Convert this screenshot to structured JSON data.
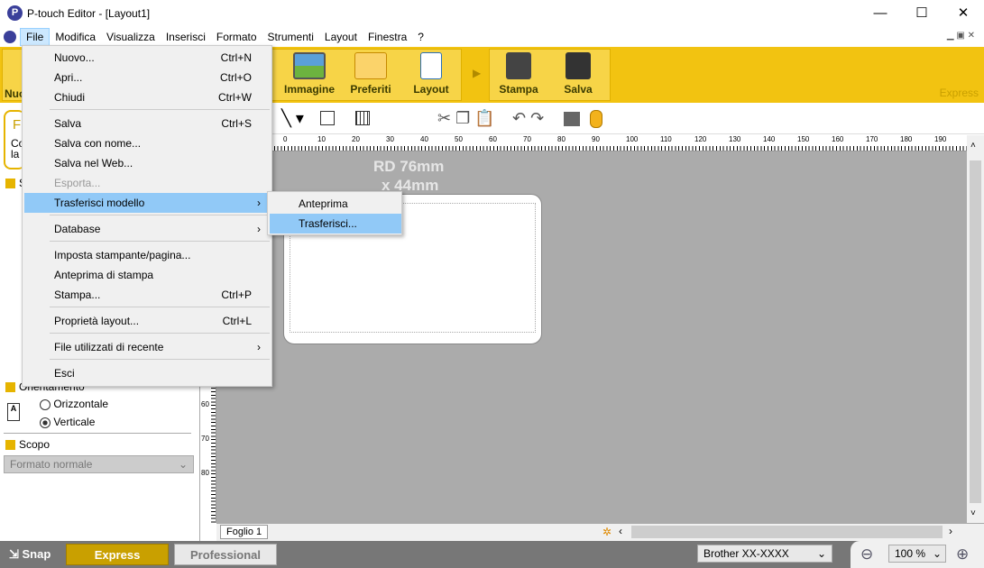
{
  "window": {
    "title": "P-touch Editor - [Layout1]",
    "minimize": "—",
    "maximize": "☐",
    "close": "✕"
  },
  "menubar": [
    "File",
    "Modifica",
    "Visualizza",
    "Inserisci",
    "Formato",
    "Strumenti",
    "Layout",
    "Finestra",
    "?"
  ],
  "ribbon": {
    "left_partial": "Nuo",
    "buttons": [
      "Immagine",
      "Preferiti",
      "Layout",
      "Stampa",
      "Salva"
    ],
    "mode": "Express"
  },
  "file_menu": [
    {
      "label": "Nuovo...",
      "shortcut": "Ctrl+N"
    },
    {
      "label": "Apri...",
      "shortcut": "Ctrl+O"
    },
    {
      "label": "Chiudi",
      "shortcut": "Ctrl+W"
    },
    {
      "label": "Salva",
      "shortcut": "Ctrl+S"
    },
    {
      "label": "Salva con nome...",
      "shortcut": ""
    },
    {
      "label": "Salva nel Web...",
      "shortcut": ""
    },
    {
      "label": "Esporta...",
      "shortcut": "",
      "disabled": true
    },
    {
      "label": "Trasferisci modello",
      "shortcut": "",
      "submenu": true,
      "highlighted": true
    },
    {
      "label": "Database",
      "shortcut": "",
      "submenu": true
    },
    {
      "label": "Imposta stampante/pagina...",
      "shortcut": ""
    },
    {
      "label": "Anteprima di stampa",
      "shortcut": ""
    },
    {
      "label": "Stampa...",
      "shortcut": "Ctrl+P"
    },
    {
      "label": "Proprietà layout...",
      "shortcut": "Ctrl+L"
    },
    {
      "label": "File utilizzati di recente",
      "shortcut": "",
      "submenu": true
    },
    {
      "label": "Esci",
      "shortcut": ""
    }
  ],
  "submenu": [
    {
      "label": "Anteprima"
    },
    {
      "label": "Trasferisci...",
      "highlighted": true
    }
  ],
  "canvas": {
    "media_line1": "RD 76mm",
    "media_line2": "x 44mm"
  },
  "ruler_ticks": [
    "0",
    "10",
    "20",
    "30",
    "40",
    "50",
    "60",
    "70",
    "80",
    "90",
    "100",
    "110",
    "120",
    "130",
    "140",
    "150",
    "160",
    "170",
    "180",
    "190"
  ],
  "vruler_ticks": [
    "60",
    "70",
    "80"
  ],
  "left_panel": {
    "partial_title": "F",
    "partial_text1": "Co",
    "partial_text2": "la",
    "section_s": "S",
    "orientation": "Orientamento",
    "orient_h": "Orizzontale",
    "orient_v": "Verticale",
    "orientation_selected": "Verticale",
    "scope": "Scopo",
    "scope_value": "Formato normale"
  },
  "sheet_tab": "Foglio 1",
  "status": {
    "snap": "Snap",
    "express": "Express",
    "professional": "Professional",
    "printer": "Brother  XX-XXXX",
    "zoom": "100 %"
  },
  "colors": {
    "ribbon": "#f2c311",
    "highlight": "#91c9f7",
    "canvas": "#ababab"
  }
}
